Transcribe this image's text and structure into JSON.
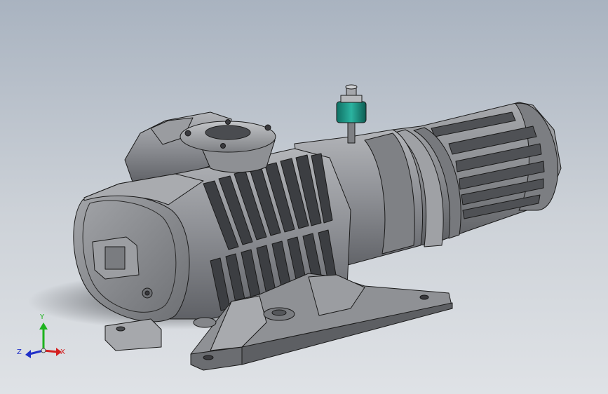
{
  "viewport": {
    "background_top": "#a9b3c0",
    "background_bottom": "#dfe2e6"
  },
  "model": {
    "body_color": "#8d8f93",
    "shade_color": "#5f6166",
    "highlight_color": "#b3b5b9",
    "edge_color": "#1a1a1a",
    "accent_color": "#1f9a8a"
  },
  "triad": {
    "y_label": "Y",
    "x_label": "X",
    "z_label": "Z",
    "y_color": "#1db31d",
    "x_color": "#d42020",
    "z_color": "#2030c8"
  }
}
